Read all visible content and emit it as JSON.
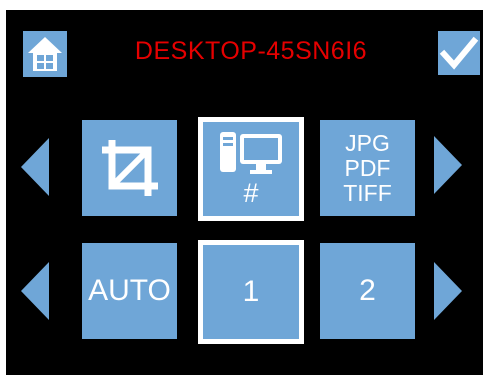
{
  "header": {
    "title": "DESKTOP-45SN6I6",
    "home_icon": "home-icon",
    "confirm_icon": "checkmark-icon"
  },
  "row1": {
    "crop_icon": "crop-icon",
    "destination": {
      "icon": "computer-icon",
      "label": "#"
    },
    "formats": [
      "JPG",
      "PDF",
      "TIFF"
    ]
  },
  "row2": {
    "auto_label": "AUTO",
    "option1": "1",
    "option2": "2"
  },
  "colors": {
    "background": "#000000",
    "tile": "#6fa6d7",
    "title": "#e50000",
    "selected_border": "#ffffff"
  }
}
